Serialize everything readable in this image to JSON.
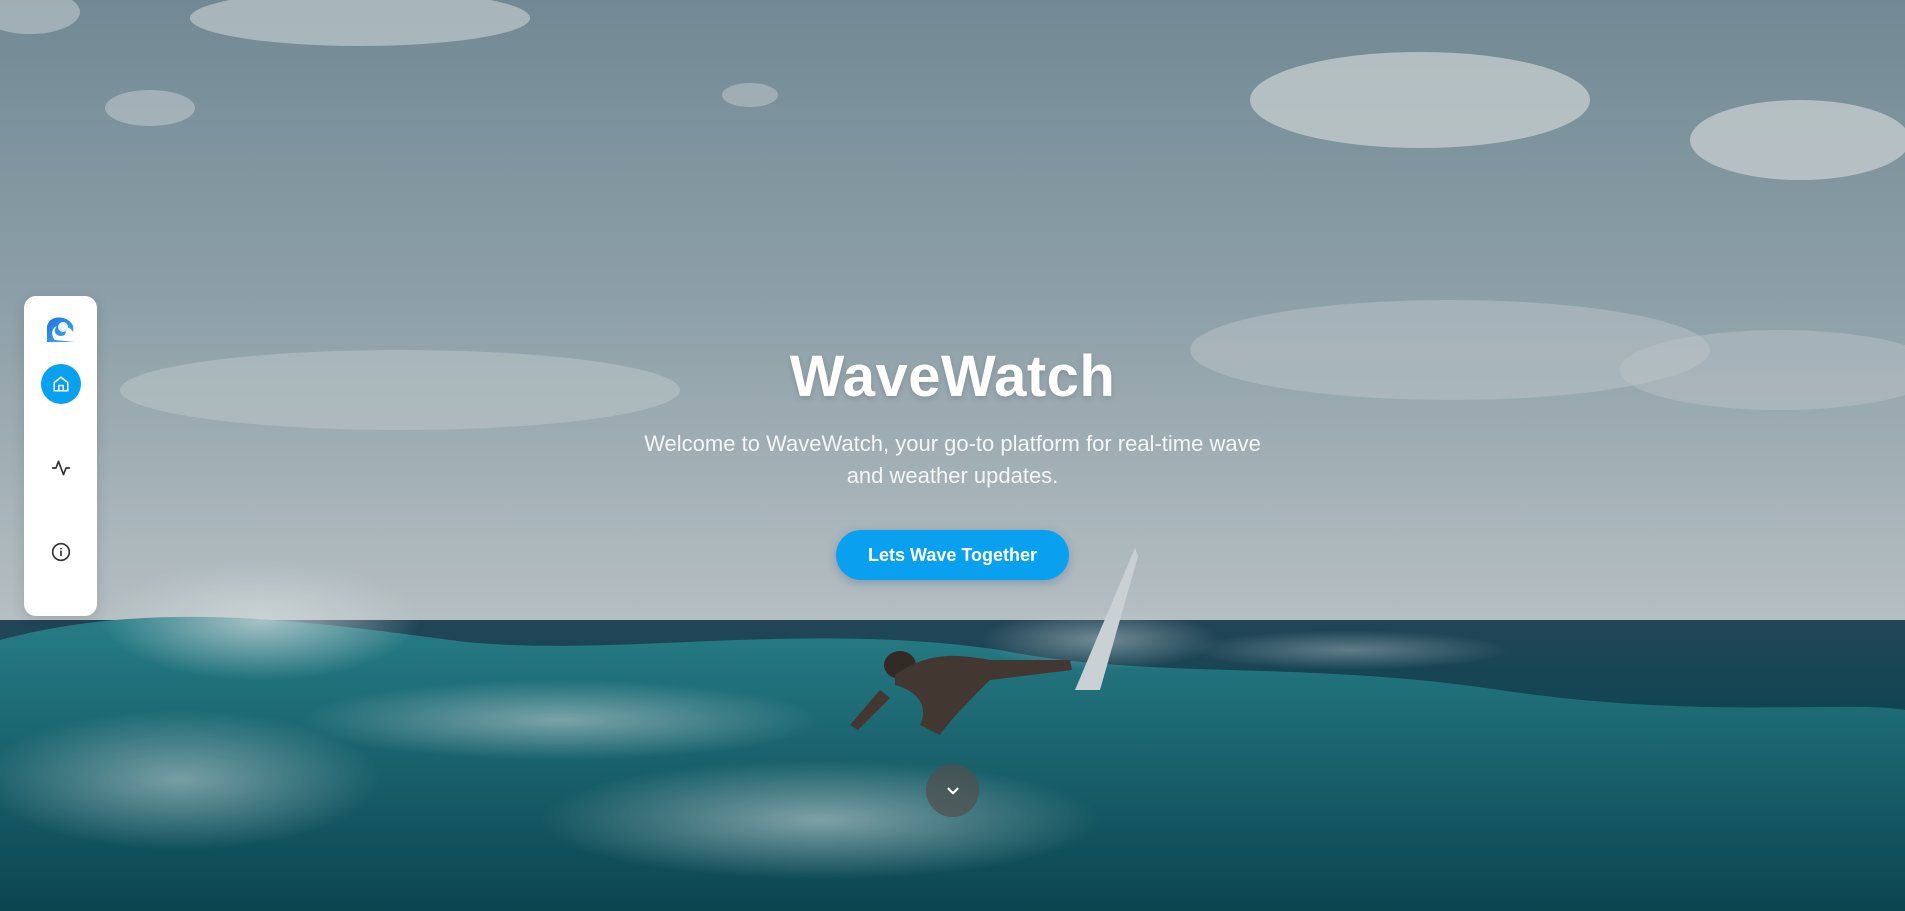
{
  "hero": {
    "title": "WaveWatch",
    "subtitle": "Welcome to WaveWatch, your go-to platform for real-time wave and weather updates.",
    "cta_label": "Lets Wave Together",
    "background_image": "surfer riding ocean wave"
  },
  "sidebar": {
    "items": [
      {
        "name": "logo",
        "icon": "wave-logo-icon"
      },
      {
        "name": "home",
        "icon": "home-icon",
        "active": true
      },
      {
        "name": "activity",
        "icon": "activity-icon"
      },
      {
        "name": "info",
        "icon": "info-icon"
      }
    ]
  },
  "scroll_button": {
    "icon": "chevron-down-icon"
  },
  "colors": {
    "accent": "#0aa0f0",
    "sidebar_bg": "#ffffff",
    "title": "#ffffff",
    "scroll_button_bg": "#505050"
  }
}
